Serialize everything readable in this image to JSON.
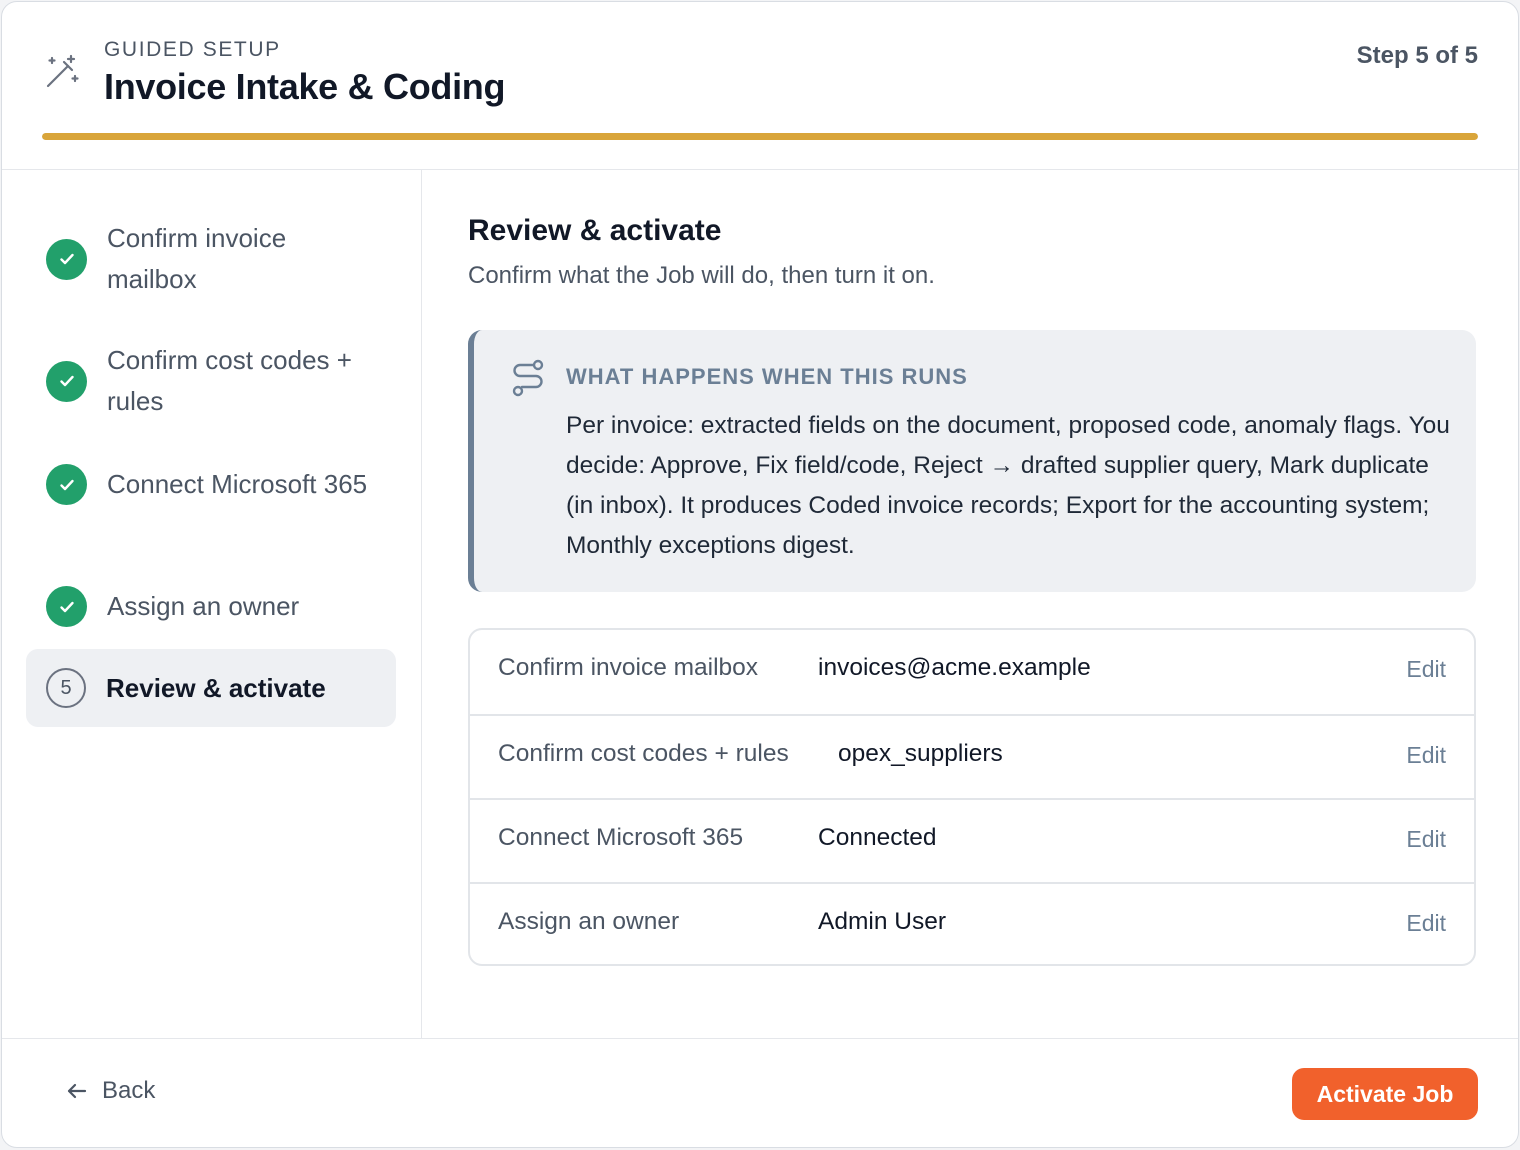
{
  "header": {
    "eyebrow": "GUIDED SETUP",
    "title": "Invoice Intake & Coding",
    "step_count": "Step 5 of 5",
    "progress": 1.0,
    "progress_color": "#d9a53a"
  },
  "sidebar": {
    "steps": [
      {
        "label": "Confirm invoice mailbox",
        "state": "complete"
      },
      {
        "label": "Confirm cost codes + rules",
        "state": "complete"
      },
      {
        "label": "Connect Microsoft 365",
        "state": "complete"
      },
      {
        "label": "Assign an owner",
        "state": "complete"
      },
      {
        "label": "Review & activate",
        "state": "active",
        "number": "5"
      }
    ]
  },
  "main": {
    "title": "Review & activate",
    "subtitle": "Confirm what the Job will do, then turn it on.",
    "callout": {
      "icon": "flow-icon",
      "heading": "WHAT HAPPENS WHEN THIS RUNS",
      "body": "Per invoice: extracted fields on the document, proposed code, anomaly flags. You decide: Approve, Fix field/code, Reject → drafted supplier query, Mark duplicate (in inbox). It produces Coded invoice records; Export for the accounting system; Monthly exceptions digest."
    },
    "summary": [
      {
        "label": "Confirm invoice mailbox",
        "value": "invoices@acme.example",
        "edit": "Edit"
      },
      {
        "label": "Confirm cost codes + rules",
        "value": "opex_suppliers",
        "edit": "Edit"
      },
      {
        "label": "Connect Microsoft 365",
        "value": "Connected",
        "edit": "Edit"
      },
      {
        "label": "Assign an owner",
        "value": "Admin User",
        "edit": "Edit"
      }
    ]
  },
  "footer": {
    "back_label": "Back",
    "activate_label": "Activate Job",
    "accent": "#f1612c"
  },
  "colors": {
    "success": "#22a06b",
    "muted_blue": "#6b7f95"
  }
}
